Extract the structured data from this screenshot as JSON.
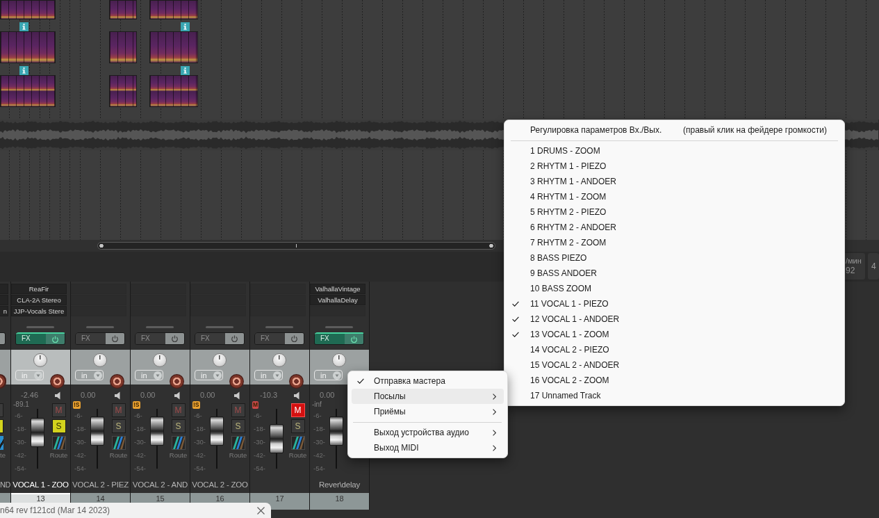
{
  "sends_submenu": {
    "header": {
      "label": "Регулировка параметров Вх./Вых.",
      "hint": "(правый клик на фейдере громкости)"
    },
    "items": [
      {
        "label": "1 DRUMS - ZOOM",
        "checked": false
      },
      {
        "label": "2 RHYTM 1 - PIEZO",
        "checked": false
      },
      {
        "label": "3 RHYTM 1 - ANDOER",
        "checked": false
      },
      {
        "label": "4 RHYTM 1 - ZOOM",
        "checked": false
      },
      {
        "label": "5 RHYTM 2 - PIEZO",
        "checked": false
      },
      {
        "label": "6 RHYTM 2 - ANDOER",
        "checked": false
      },
      {
        "label": "7 RHYTM 2 - ZOOM",
        "checked": false
      },
      {
        "label": "8 BASS PIEZO",
        "checked": false
      },
      {
        "label": "9 BASS ANDOER",
        "checked": false
      },
      {
        "label": "10 BASS ZOOM",
        "checked": false
      },
      {
        "label": "11 VOCAL 1 - PIEZO",
        "checked": true
      },
      {
        "label": "12 VOCAL 1 - ANDOER",
        "checked": true
      },
      {
        "label": "13 VOCAL 1 - ZOOM",
        "checked": true
      },
      {
        "label": "14 VOCAL 2 - PIEZO",
        "checked": false
      },
      {
        "label": "15 VOCAL 2 - ANDOER",
        "checked": false
      },
      {
        "label": "16 VOCAL 2 - ZOOM",
        "checked": false
      },
      {
        "label": "17 Unnamed Track",
        "checked": false
      }
    ]
  },
  "tempo_box": {
    "label": "/мин",
    "value": "92"
  },
  "side_box": {
    "value": "4"
  },
  "mixer": {
    "partial_strip": {
      "fx_slot_3": "n",
      "record_armed": false,
      "muted": false,
      "solo": true,
      "route_label": "te",
      "name": "ND"
    },
    "strips": [
      {
        "fx": [
          "ReaFir",
          "CLA-2A Stereo",
          "JJP-Vocals Stere"
        ],
        "fx_button": {
          "label": "FX",
          "active": true
        },
        "input": "in",
        "record_armed": false,
        "volume": "-2.46",
        "peak": "-89.1",
        "scale": [
          "-6-",
          "-18-",
          "-30-",
          "-42-",
          "-54-"
        ],
        "level": 0.71,
        "mute": {
          "label": "M",
          "on": false
        },
        "solo": {
          "label": "S",
          "on": true
        },
        "route_label": "Route",
        "name": "VOCAL 1 - ZOO",
        "number": "13",
        "selected": true
      },
      {
        "fx_button": {
          "label": "FX",
          "active": false
        },
        "input": "in",
        "record_armed": false,
        "volume": "0.00",
        "indicator": {
          "text": "!S",
          "color": "#e8a030"
        },
        "scale": [
          "-6-",
          "-18-",
          "-30-",
          "-42-",
          "-54-"
        ],
        "level": 0.75,
        "mute": {
          "label": "M",
          "on": false
        },
        "solo": {
          "label": "S",
          "on": false
        },
        "route_label": "Route",
        "name": "VOCAL 2 - PIEZ",
        "number": "14",
        "selected": false
      },
      {
        "fx_button": {
          "label": "FX",
          "active": false
        },
        "input": "in",
        "record_armed": false,
        "volume": "0.00",
        "indicator": {
          "text": "!S",
          "color": "#e8a030"
        },
        "scale": [
          "-6-",
          "-18-",
          "-30-",
          "-42-",
          "-54-"
        ],
        "level": 0.75,
        "mute": {
          "label": "M",
          "on": false
        },
        "solo": {
          "label": "S",
          "on": false
        },
        "route_label": "Route",
        "name": "VOCAL 2 - AND",
        "number": "15",
        "selected": false
      },
      {
        "fx_button": {
          "label": "FX",
          "active": false
        },
        "input": "in",
        "record_armed": false,
        "volume": "0.00",
        "indicator": {
          "text": "!S",
          "color": "#e8a030"
        },
        "scale": [
          "-6-",
          "-18-",
          "-30-",
          "-42-",
          "-54-"
        ],
        "level": 0.75,
        "mute": {
          "label": "M",
          "on": false
        },
        "solo": {
          "label": "S",
          "on": false
        },
        "route_label": "Route",
        "name": "VOCAL 2 - ZOO",
        "number": "16",
        "selected": false
      },
      {
        "fx_button": {
          "label": "FX",
          "active": false
        },
        "input": "in",
        "record_armed": false,
        "volume": "-10.3",
        "indicator": {
          "text": "M",
          "color": "#c94848"
        },
        "scale": [
          "-6-",
          "-18-",
          "-30-",
          "-42-",
          "-54-"
        ],
        "level": 0.5,
        "mute": {
          "label": "M",
          "on": true
        },
        "solo": {
          "label": "S",
          "on": false
        },
        "route_label": "Route",
        "number": "17",
        "selected": false
      },
      {
        "fx": [
          "ValhallaVintage",
          "ValhallaDelay"
        ],
        "fx_button": {
          "label": "FX",
          "active": true
        },
        "input": "in",
        "volume": "0.00",
        "peak": "-inf",
        "scale": [
          "-6-",
          "-18-",
          "-30-",
          "-42-",
          "-54-"
        ],
        "level": 0.75,
        "name": "Rever\\delay",
        "number": "18",
        "selected": false
      }
    ]
  },
  "context_menu": {
    "items": [
      {
        "kind": "item",
        "label": "Отправка мастера",
        "checked": true,
        "submenu": false,
        "highlighted": false
      },
      {
        "kind": "item",
        "label": "Посылы",
        "checked": false,
        "submenu": true,
        "highlighted": true
      },
      {
        "kind": "item",
        "label": "Приёмы",
        "checked": false,
        "submenu": true,
        "highlighted": false
      },
      {
        "kind": "separator"
      },
      {
        "kind": "item",
        "label": "Выход устройства аудио",
        "checked": false,
        "submenu": true,
        "highlighted": false
      },
      {
        "kind": "item",
        "label": "Выход MIDI",
        "checked": false,
        "submenu": true,
        "highlighted": false
      }
    ]
  },
  "version_popup": {
    "text": "n64 rev f121cd (Mar 14 2023)"
  }
}
